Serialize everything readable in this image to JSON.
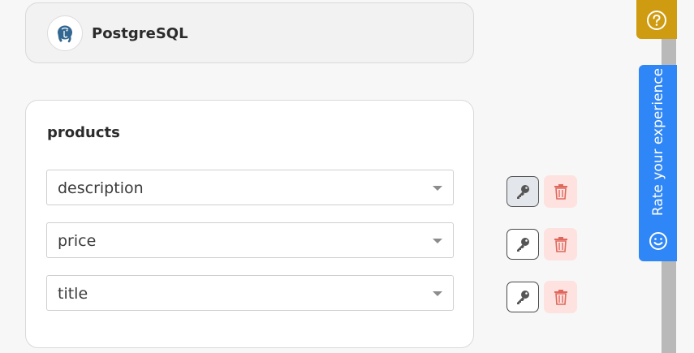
{
  "database": {
    "name": "PostgreSQL",
    "logo_icon": "postgresql-elephant-icon"
  },
  "table": {
    "name": "products",
    "fields": [
      {
        "value": "description",
        "key_active": true
      },
      {
        "value": "price",
        "key_active": false
      },
      {
        "value": "title",
        "key_active": false
      }
    ]
  },
  "side_widgets": {
    "help_icon": "question-circle-icon",
    "rate_label": "Rate your experience",
    "rate_icon": "smile-icon",
    "help_color": "#cf9b10",
    "rate_color": "#2f86f6"
  },
  "colors": {
    "delete_bg": "#fde2df",
    "delete_icon": "#e0675c",
    "key_icon": "#555555"
  }
}
